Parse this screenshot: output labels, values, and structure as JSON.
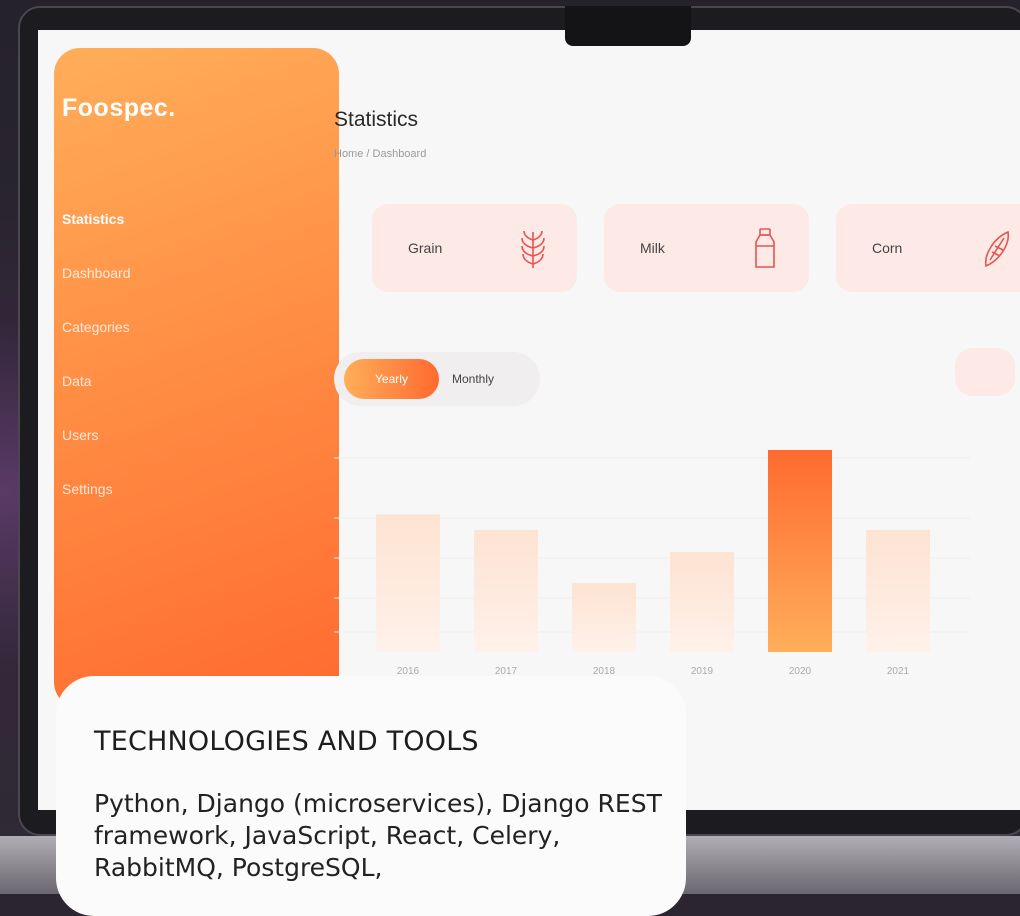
{
  "app": {
    "brand": "Foospec."
  },
  "sidebar": {
    "items": [
      {
        "label": "Statistics",
        "active": true
      },
      {
        "label": "Dashboard",
        "active": false
      },
      {
        "label": "Categories",
        "active": false
      },
      {
        "label": "Data",
        "active": false
      },
      {
        "label": "Users",
        "active": false
      },
      {
        "label": "Settings",
        "active": false
      }
    ]
  },
  "header": {
    "title": "Statistics",
    "breadcrumb": "Home / Dashboard"
  },
  "cards": [
    {
      "label": "Grain",
      "icon": "grain-icon"
    },
    {
      "label": "Milk",
      "icon": "milk-bottle-icon"
    },
    {
      "label": "Corn",
      "icon": "corn-icon"
    }
  ],
  "period_toggle": {
    "yearly": "Yearly",
    "monthly": "Monthly"
  },
  "colors": {
    "accent_start": "#ffae5a",
    "accent_end": "#ff6a2f",
    "card_bg": "#fde9e6"
  },
  "chart_data": {
    "type": "bar",
    "categories": [
      "2016",
      "2017",
      "2018",
      "2019",
      "2020",
      "2021"
    ],
    "values": [
      62,
      55,
      31,
      45,
      91,
      55
    ],
    "highlight_index": 4,
    "ylim": [
      0,
      100
    ],
    "grid": true
  },
  "info": {
    "title": "TECHNOLOGIES AND TOOLS",
    "body": "Python, Django (microservices), Django REST framework, JavaScript, React, Celery, RabbitMQ, PostgreSQL,"
  }
}
